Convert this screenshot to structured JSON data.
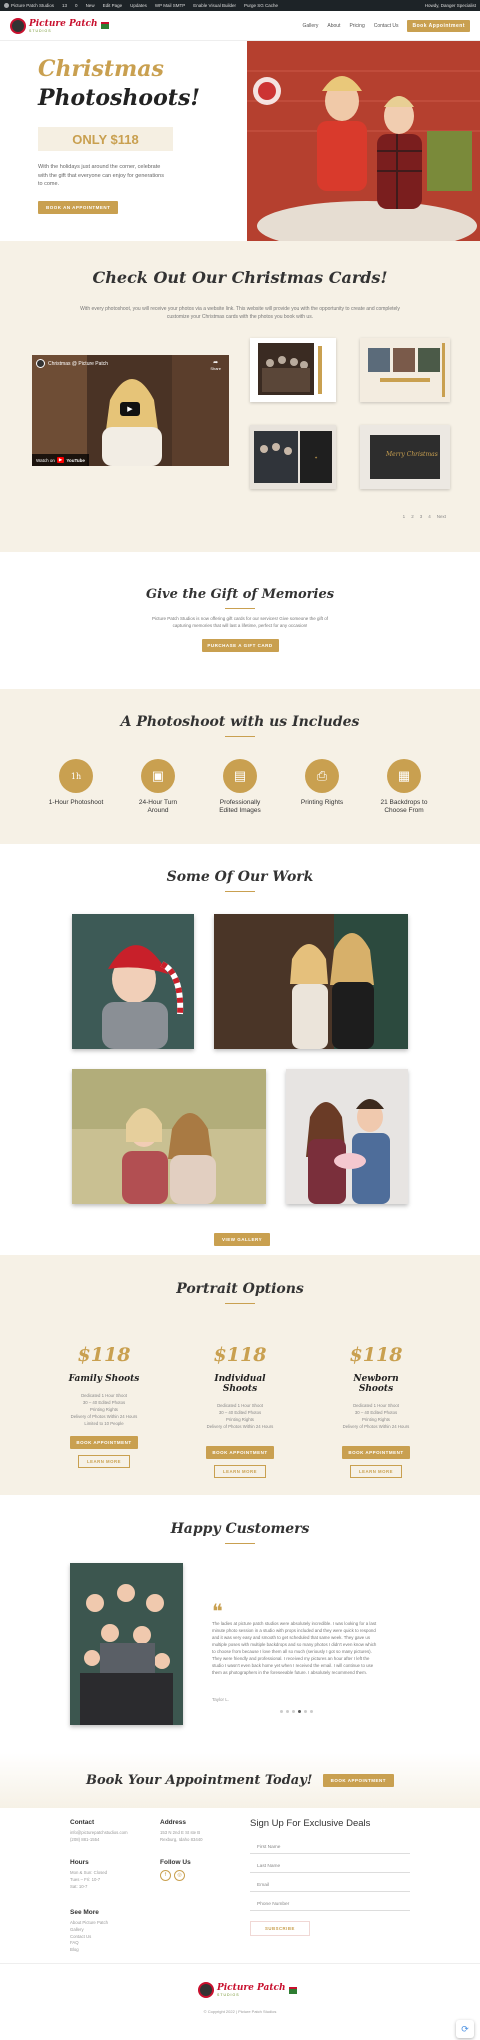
{
  "admin_bar": {
    "items": [
      "Picture Patch Studios",
      "13",
      "0",
      "New",
      "Edit Page",
      "Updates",
      "WP Mail SMTP",
      "Enable Visual Builder",
      "Purge SG Cache"
    ],
    "user": "Howdy, Danger Specialist"
  },
  "header": {
    "logo_text": "Picture Patch",
    "logo_sub": "STUDIOS",
    "nav": [
      "Gallery",
      "About",
      "Pricing",
      "Contact Us"
    ],
    "cta": "Book Appointment"
  },
  "hero": {
    "title_line1": "Christmas",
    "title_line2": "Photoshoots!",
    "price": "ONLY $118",
    "description": "With the holidays just around the corner, celebrate with the gift that everyone can enjoy for generations to come.",
    "button": "BOOK AN APPOINTMENT"
  },
  "cards": {
    "title": "Check Out Our Christmas Cards!",
    "description": "With every photoshoot, you will receive your photos via a website link. This website will provide you with the opportunity to create and completely customize your Christmas cards with the photos you book with us.",
    "video": {
      "title": "Christmas @ Picture Patch",
      "share": "Share",
      "watch_on": "Watch on",
      "platform": "YouTube"
    },
    "card_greeting": "Merry Christmas",
    "pagination": [
      "1",
      "2",
      "3",
      "4",
      "Next"
    ]
  },
  "gift": {
    "title": "Give the Gift of Memories",
    "description": "Picture Patch Studios is now offering gift cards for our services! Give someone the gift of capturing memories that will last a lifetime, perfect for any occasion!",
    "button": "PURCHASE A GIFT CARD"
  },
  "includes": {
    "title": "A Photoshoot with us Includes",
    "items": [
      {
        "label": "1-Hour Photoshoot",
        "icon": "one-hour-icon"
      },
      {
        "label": "24-Hour Turn Around",
        "icon": "turnaround-icon"
      },
      {
        "label": "Professionally Edited Images",
        "icon": "edited-images-icon"
      },
      {
        "label": "Printing Rights",
        "icon": "printer-icon"
      },
      {
        "label": "21 Backdrops to Choose From",
        "icon": "backdrops-icon"
      }
    ]
  },
  "work": {
    "title": "Some Of Our Work",
    "button": "VIEW GALLERY"
  },
  "portrait": {
    "title": "Portrait Options",
    "options": [
      {
        "price": "$118",
        "name": "Family Shoots",
        "features": [
          "Dedicated 1 Hour Shoot",
          "30 – 40 Edited Photos",
          "Printing Rights",
          "Delivery of Photos Within 24 Hours",
          "Limited to 10 People"
        ],
        "book": "BOOK APPOINTMENT",
        "learn": "LEARN MORE"
      },
      {
        "price": "$118",
        "name": "Individual Shoots",
        "features": [
          "Dedicated 1 Hour Shoot",
          "30 – 40 Edited Photos",
          "Printing Rights",
          "Delivery of Photos Within 24 Hours"
        ],
        "book": "BOOK APPOINTMENT",
        "learn": "LEARN MORE"
      },
      {
        "price": "$118",
        "name": "Newborn Shoots",
        "features": [
          "Dedicated 1 Hour Shoot",
          "30 – 40 Edited Photos",
          "Printing Rights",
          "Delivery of Photos Within 24 Hours"
        ],
        "book": "BOOK APPOINTMENT",
        "learn": "LEARN MORE"
      }
    ]
  },
  "testimonials": {
    "title": "Happy Customers",
    "quote": "The ladies at picture patch studios were absolutely incredible. I was looking for a last minute photo session in a studio with props included and they were quick to respond and it was very easy and smooth to get scheduled that same week. They gave us multiple poses with multiple backdrops and so many photos I didn't even know which to choose from because I love them all so much (seriously I got so many pictures). They were friendly and professional. I received my pictures an hour after I left the studio I wasn't even back home yet when I received the email. I will continue to use them as photographers in the foreseeable future. I absolutely recommend them.",
    "author": "Taylor L."
  },
  "book": {
    "title": "Book Your Appointment Today!",
    "button": "BOOK APPOINTMENT"
  },
  "footer": {
    "contact_head": "Contact",
    "email": "info@picturepatchstudios.com",
    "phone": "(208) 881-1554",
    "address_head": "Address",
    "address_line1": "153 N 2nd E St ste B",
    "address_line2": "Rexburg, Idaho 83440",
    "hours_head": "Hours",
    "hours": [
      "Mon & Sun: Closed",
      "Tues – Fri: 10-7",
      "Sat: 10-7"
    ],
    "follow_head": "Follow Us",
    "see_more_head": "See More",
    "see_more": [
      "About Picture Patch",
      "Gallery",
      "Contact Us",
      "FAQ",
      "Blog"
    ],
    "signup_title": "Sign Up For Exclusive Deals",
    "fields": [
      "First Name",
      "Last Name",
      "Email",
      "Phone Number"
    ],
    "subscribe": "SUBSCRIBE"
  },
  "bottom": {
    "copyright": "© Copyright 2022 | Picture Patch Studios"
  },
  "colors": {
    "gold": "#c9a050",
    "cream": "#f6f1e6",
    "brand_red": "#c8102e"
  }
}
